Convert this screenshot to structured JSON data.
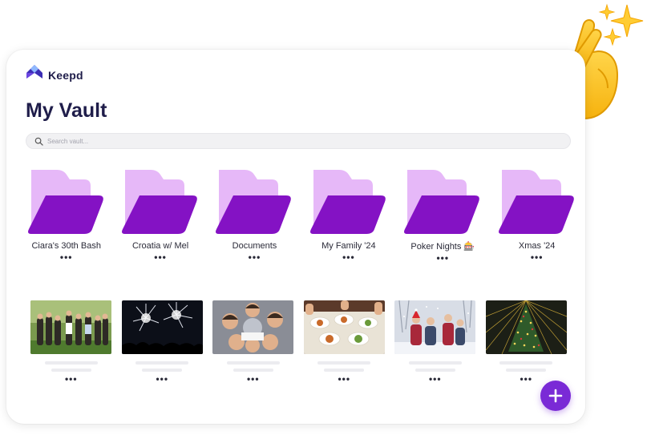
{
  "app": {
    "name": "Keepd"
  },
  "page": {
    "title": "My Vault"
  },
  "search": {
    "placeholder": "Search vault..."
  },
  "folders": [
    {
      "label": "Ciara's 30th Bash"
    },
    {
      "label": "Croatia w/ Mel"
    },
    {
      "label": "Documents"
    },
    {
      "label": "My Family '24"
    },
    {
      "label": "Poker Nights 🎰"
    },
    {
      "label": "Xmas '24"
    }
  ],
  "more_label": "•••",
  "photos": [
    {
      "scene": "group-outdoor-photo"
    },
    {
      "scene": "fireworks-photo"
    },
    {
      "scene": "group-selfie-photo"
    },
    {
      "scene": "dinner-table-photo"
    },
    {
      "scene": "snow-friends-photo"
    },
    {
      "scene": "christmas-tree-photo"
    }
  ],
  "fab": {
    "icon": "plus-icon"
  },
  "decorations": {
    "hand": "crossed-fingers-emoji",
    "sparkle": "sparkles-emoji"
  },
  "colors": {
    "brand_dark": "#1f1d4a",
    "folder_back": "#e6b8f8",
    "folder_front": "#8412c4",
    "fab": "#7a2ad6",
    "search_bg": "#f1f1f3"
  }
}
